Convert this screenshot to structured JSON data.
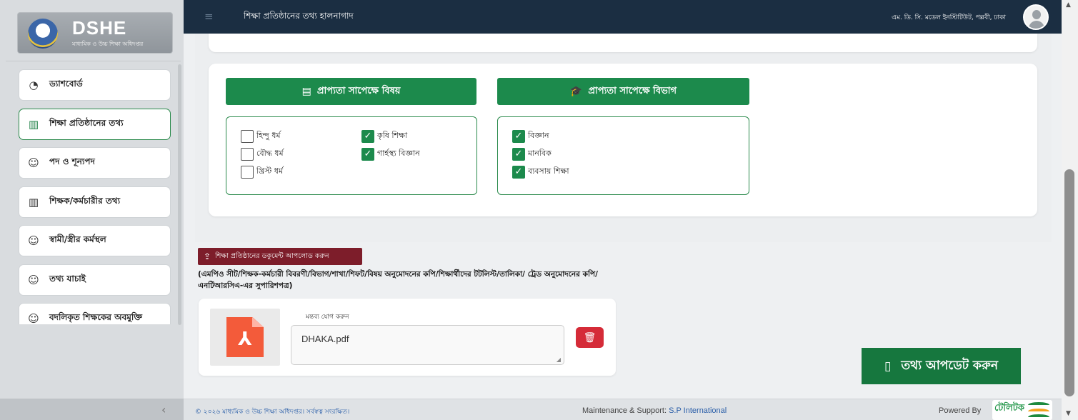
{
  "brand": {
    "title": "DSHE",
    "subtitle": "মাধ্যমিক ও উচ্চ শিক্ষা অধিদপ্তর"
  },
  "sidebar": {
    "items": [
      {
        "label": "ড্যাশবোর্ড",
        "icon": "dashboard-icon",
        "glyph": "◔"
      },
      {
        "label": "শিক্ষা প্রতিষ্ঠানের তথ্য",
        "icon": "institution-icon",
        "glyph": "▥"
      },
      {
        "label": "পদ ও শূন্যপদ",
        "icon": "user-icon",
        "glyph": "☺"
      },
      {
        "label": "শিক্ষক/কর্মচারীর তথ্য",
        "icon": "staff-icon",
        "glyph": "▥"
      },
      {
        "label": "স্বামী/স্ত্রীর কর্মস্থল",
        "icon": "user-icon",
        "glyph": "☺"
      },
      {
        "label": "তথ্য যাচাই",
        "icon": "user-icon",
        "glyph": "☺"
      },
      {
        "label": "বদলিকৃত শিক্ষকের অবমুক্তি",
        "icon": "user-icon",
        "glyph": "☺"
      }
    ],
    "active_index": 1
  },
  "topbar": {
    "title": "শিক্ষা প্রতিষ্ঠানের তথ্য হালনাগাদ",
    "institution": "এম. ডি. সি. মডেল ইনস্টিটিউট, পল্লবী, ঢাকা"
  },
  "subjects": {
    "heading": "প্রাপ্যতা সাপেক্ষে বিষয়",
    "items": [
      {
        "label": "হিন্দু ধর্ম",
        "checked": false
      },
      {
        "label": "বৌদ্ধ ধর্ম",
        "checked": false
      },
      {
        "label": "খ্রিস্ট ধর্ম",
        "checked": false
      },
      {
        "label": "কৃষি শিক্ষা",
        "checked": true
      },
      {
        "label": "গার্হস্থ্য বিজ্ঞান",
        "checked": true
      }
    ]
  },
  "departments": {
    "heading": "প্রাপ্যতা সাপেক্ষে বিভাগ",
    "items": [
      {
        "label": "বিজ্ঞান",
        "checked": true
      },
      {
        "label": "মানবিক",
        "checked": true
      },
      {
        "label": "ব্যবসায় শিক্ষা",
        "checked": true
      }
    ]
  },
  "upload": {
    "button_label": "শিক্ষা প্রতিষ্ঠানের ডকুমেন্ট আপলোড করুন",
    "description": "(এমপিও সীট/শিক্ষক-কর্মচারী বিবরণী/বিভাগ/শাখা/শিফট/বিষয় অনুমোদনের কপি/শিক্ষার্থীদের টটলিস্ট/তালিকা/ ট্রেড অনুমোদনের কপি/এনটিআরসিএ-এর সুপারিশপত্র)"
  },
  "document": {
    "comment_label": "মন্তব্য যোগ করুন",
    "filename": "DHAKA.pdf"
  },
  "update_button": {
    "label": "তথ্য আপডেট করুন"
  },
  "footer": {
    "copyright": "© ২০২৬ মাধ্যমিক ও উচ্চ শিক্ষা অধিদপ্তর। সর্বস্বত্ব সংরক্ষিত।",
    "maintenance_label": "Maintenance & Support:",
    "maintenance_company": "S.P International",
    "powered_label": "Powered By",
    "powered_logo_text": "টেলিটক"
  },
  "colors": {
    "primary_green": "#1c8a4c",
    "topbar": "#1b2e42",
    "upload_red": "#7d1d2a",
    "delete_red": "#d52b38"
  }
}
